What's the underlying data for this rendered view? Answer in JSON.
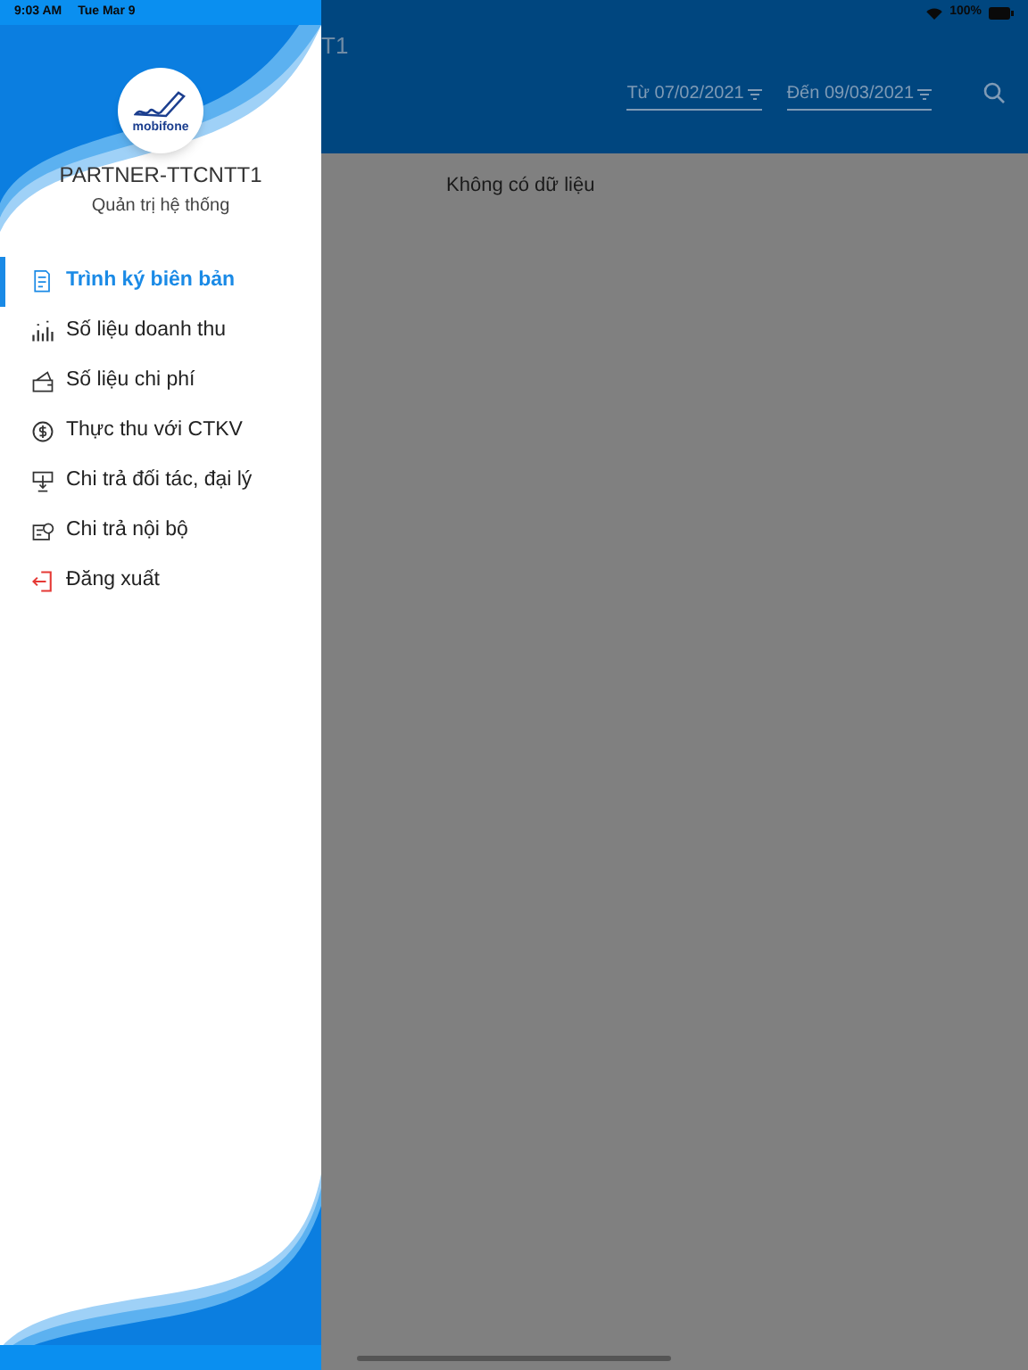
{
  "status_bar": {
    "time": "9:03 AM",
    "date": "Tue Mar 9",
    "battery": "100%"
  },
  "header": {
    "title": "T1",
    "filters": [
      {
        "label": "Từ 07/02/2021"
      },
      {
        "label": "Đến 09/03/2021"
      }
    ]
  },
  "content": {
    "empty_message": "Không có dữ liệu"
  },
  "drawer": {
    "logo_text": "mobifone",
    "user_name": "PARTNER-TTCNTT1",
    "role": "Quản trị hệ thống",
    "items": [
      {
        "label": "Trình ký biên bản",
        "kind": "document",
        "selected": true
      },
      {
        "label": "Số liệu doanh thu",
        "kind": "bars",
        "selected": false
      },
      {
        "label": "Số liệu chi phí",
        "kind": "wallet",
        "selected": false
      },
      {
        "label": "Thực thu với CTKV",
        "kind": "coin",
        "selected": false
      },
      {
        "label": "Chi trả đối tác, đại lý",
        "kind": "transfer",
        "selected": false
      },
      {
        "label": "Chi trả nội bộ",
        "kind": "card",
        "selected": false
      },
      {
        "label": "Đăng xuất",
        "kind": "logout",
        "selected": false
      }
    ]
  }
}
